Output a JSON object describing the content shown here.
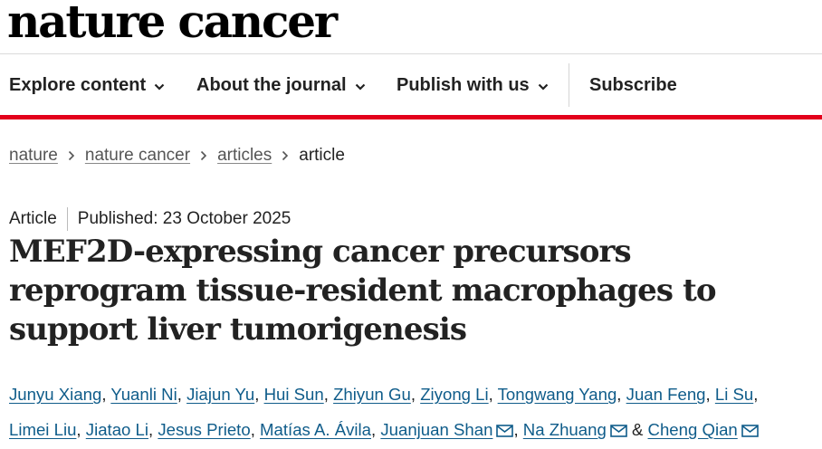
{
  "site": {
    "logo": "nature cancer"
  },
  "nav": {
    "items": [
      {
        "label": "Explore content",
        "icon": "chevron-down-icon"
      },
      {
        "label": "About the journal",
        "icon": "chevron-down-icon"
      },
      {
        "label": "Publish with us",
        "icon": "chevron-down-icon"
      }
    ],
    "subscribe": "Subscribe"
  },
  "breadcrumb": {
    "items": [
      "nature",
      "nature cancer",
      "articles"
    ],
    "current": "article"
  },
  "article": {
    "type": "Article",
    "published": "Published: 23 October 2025",
    "title": "MEF2D-expressing cancer precursors reprogram tissue-resident macrophages to support liver tumorigenesis",
    "authors": [
      {
        "name": "Junyu Xiang"
      },
      {
        "name": "Yuanli Ni"
      },
      {
        "name": "Jiajun Yu"
      },
      {
        "name": "Hui Sun"
      },
      {
        "name": "Zhiyun Gu"
      },
      {
        "name": "Ziyong Li"
      },
      {
        "name": "Tongwang Yang"
      },
      {
        "name": "Juan Feng"
      },
      {
        "name": "Li Su"
      },
      {
        "name": "Limei Liu"
      },
      {
        "name": "Jiatao Li"
      },
      {
        "name": "Jesus Prieto"
      },
      {
        "name": "Matías A. Ávila"
      },
      {
        "name": "Juanjuan Shan",
        "mail": true
      },
      {
        "name": "Na Zhuang",
        "mail": true
      },
      {
        "name": "Cheng Qian",
        "mail": true
      }
    ],
    "and": "&"
  },
  "colors": {
    "accent": "#e3001b",
    "link": "#0f5c8a",
    "text": "#222222"
  }
}
